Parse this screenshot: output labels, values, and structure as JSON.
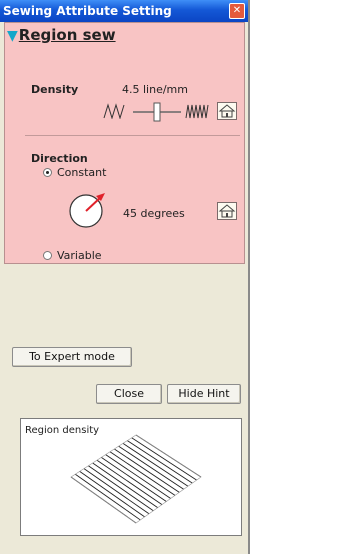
{
  "window": {
    "title": "Sewing Attribute Setting",
    "close_glyph": "✕"
  },
  "region": {
    "heading": "Region sew",
    "density": {
      "label": "Density",
      "value": "4.5 line/mm",
      "slider_level": 0.5
    },
    "direction": {
      "label": "Direction",
      "constant_label": "Constant",
      "variable_label": "Variable",
      "selected": "Constant",
      "angle": "45 degrees"
    }
  },
  "buttons": {
    "expert": "To Expert mode",
    "close": "Close",
    "hide_hint": "Hide Hint"
  },
  "hint": {
    "title": "Region density"
  },
  "colors": {
    "panel": "#f8c4c4",
    "titlebar": "#1458d6",
    "accent_arrow": "#e0212a"
  }
}
